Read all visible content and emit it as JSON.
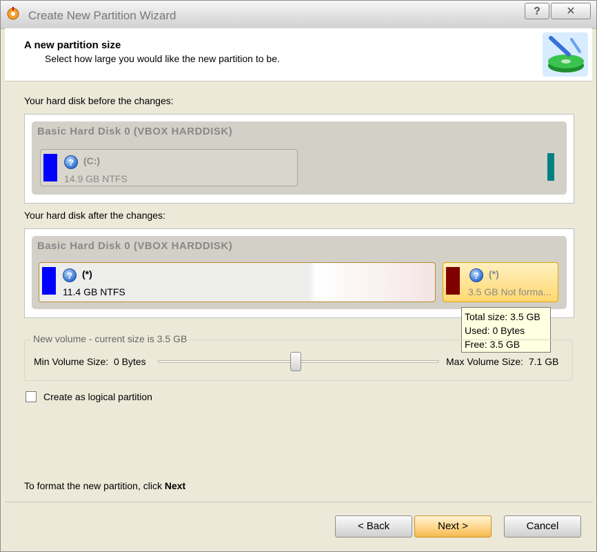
{
  "window": {
    "title": "Create New Partition Wizard",
    "help_label": "?",
    "close_label": "✕"
  },
  "header": {
    "title": "A new partition size",
    "subtitle": "Select how large you would like the new partition to be."
  },
  "before": {
    "label": "Your hard disk before the changes:",
    "disk_name": "Basic Hard Disk 0 (VBOX HARDDISK)",
    "partition": {
      "name": "(C:)",
      "info": "14.9 GB NTFS",
      "color": "#0000ff"
    },
    "tail_color": "#008080"
  },
  "after": {
    "label": "Your hard disk after the changes:",
    "disk_name": "Basic Hard Disk 0 (VBOX HARDDISK)",
    "partition1": {
      "name": "(*)",
      "info": "11.4 GB NTFS",
      "color": "#0000ff"
    },
    "partition2": {
      "name": "(*)",
      "info": "3.5 GB Not forma...",
      "color": "#800000"
    }
  },
  "tooltip": {
    "total": "Total size: 3.5 GB",
    "used": "Used: 0 Bytes",
    "free": "Free: 3.5 GB"
  },
  "volume": {
    "legend": "New volume - current size is 3.5 GB",
    "min_label": "Min Volume Size:",
    "min_value": "0 Bytes",
    "max_label": "Max Volume Size:",
    "max_value": "7.1 GB",
    "slider_position": 0.49
  },
  "logical": {
    "label": "Create as logical partition",
    "checked": false
  },
  "footer": {
    "instruction_prefix": "To format the new partition, click",
    "instruction_bold": "Next"
  },
  "buttons": {
    "back": "< Back",
    "next": "Next >",
    "cancel": "Cancel"
  },
  "icons": {
    "app": "partition-wizard-icon",
    "header": "disk-wizard-icon",
    "partition": "question-icon"
  }
}
